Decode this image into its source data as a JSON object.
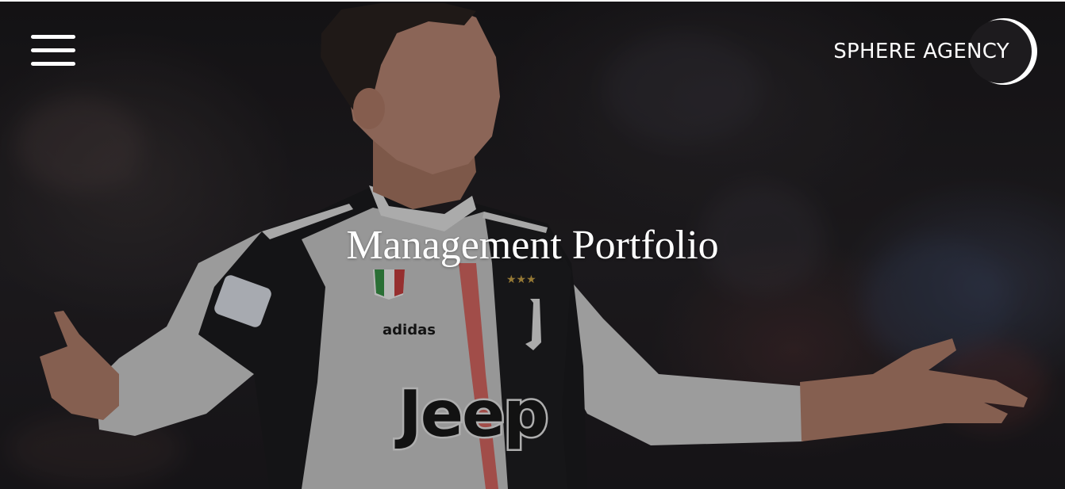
{
  "header": {
    "brand_name": "SPHERE AGENCY",
    "menu_icon": "hamburger-menu-icon",
    "logo_icon": "crescent-logo-icon"
  },
  "hero": {
    "title": "Management Portfolio",
    "image": "football-player-celebrating-photo"
  },
  "colors": {
    "text": "#ffffff",
    "overlay": "#000000",
    "jersey_stripe": "#e0605c"
  }
}
